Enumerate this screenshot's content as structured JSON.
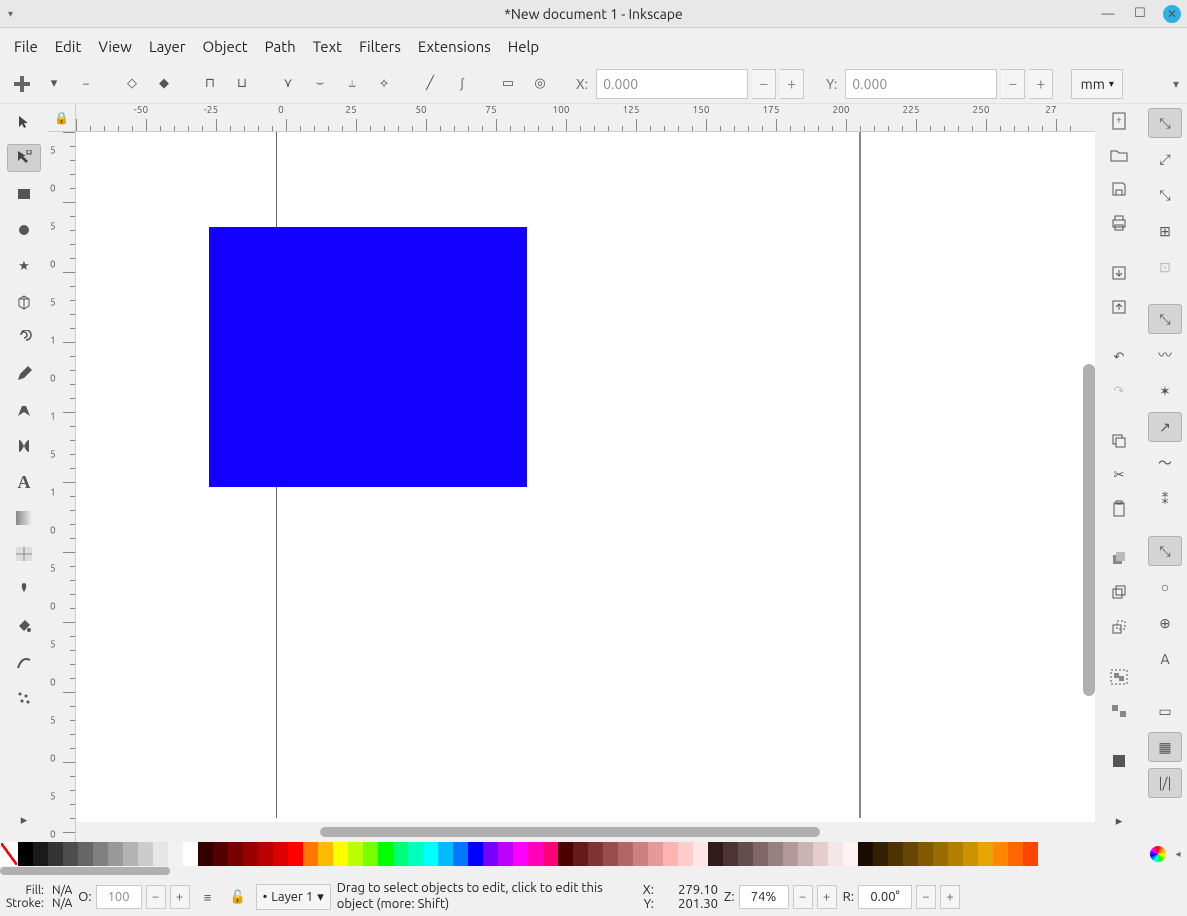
{
  "window": {
    "title": "*New document 1 - Inkscape"
  },
  "menubar": [
    "File",
    "Edit",
    "View",
    "Layer",
    "Object",
    "Path",
    "Text",
    "Filters",
    "Extensions",
    "Help"
  ],
  "options_bar": {
    "x_label": "X:",
    "x_value": "0.000",
    "y_label": "Y:",
    "y_value": "0.000",
    "unit": "mm"
  },
  "ruler_h_labels": [
    "-50",
    "-25",
    "0",
    "25",
    "50",
    "75",
    "100",
    "125",
    "150",
    "175",
    "200",
    "225",
    "250",
    "27"
  ],
  "ruler_v_labels": [
    "5",
    "0",
    "5",
    "0",
    "5",
    "1",
    "0",
    "1",
    "5",
    "1",
    "0",
    "5",
    "0",
    "5",
    "0",
    "5",
    "0",
    "5",
    "0"
  ],
  "canvas": {
    "shape": {
      "type": "rect",
      "fill": "#1300ff"
    }
  },
  "palette": [
    "#000000",
    "#1a1a1a",
    "#333333",
    "#4d4d4d",
    "#666666",
    "#808080",
    "#999999",
    "#b3b3b3",
    "#cccccc",
    "#e6e6e6",
    "#f2f2f2",
    "#ffffff",
    "#330000",
    "#550000",
    "#770000",
    "#990000",
    "#bb0000",
    "#dd0000",
    "#ff0000",
    "#ff7700",
    "#ffbb00",
    "#ffff00",
    "#bbff00",
    "#77ff00",
    "#00ff00",
    "#00ff77",
    "#00ffbb",
    "#00ffff",
    "#00bbff",
    "#0077ff",
    "#0000ff",
    "#7700ff",
    "#bb00ff",
    "#ff00ff",
    "#ff00bb",
    "#ff0077",
    "#4d0000",
    "#661a1a",
    "#803333",
    "#994d4d",
    "#b36666",
    "#cc8080",
    "#e69999",
    "#ffb3b3",
    "#ffcccc",
    "#ffe6e6",
    "#331a1a",
    "#4d3333",
    "#664d4d",
    "#806666",
    "#998080",
    "#b39999",
    "#ccb3b3",
    "#e6cccc",
    "#f2e6e6",
    "#fff2f2",
    "#1a0d00",
    "#332000",
    "#4d3300",
    "#664600",
    "#805900",
    "#996c00",
    "#b37f00",
    "#cc9200",
    "#e6a500",
    "#ff8800",
    "#ff6600",
    "#ff4400"
  ],
  "status": {
    "fill_label": "Fill:",
    "fill_value": "N/A",
    "stroke_label": "Stroke:",
    "stroke_value": "N/A",
    "opacity_label": "O:",
    "opacity_value": "100",
    "layer_label": "Layer 1",
    "hint": "Drag to select objects to edit, click to edit this object (more: Shift)",
    "cursor_x_label": "X:",
    "cursor_x": "279.10",
    "cursor_y_label": "Y:",
    "cursor_y": "201.30",
    "zoom_label": "Z:",
    "zoom_value": "74%",
    "rotate_label": "R:",
    "rotate_value": "0.00°"
  }
}
